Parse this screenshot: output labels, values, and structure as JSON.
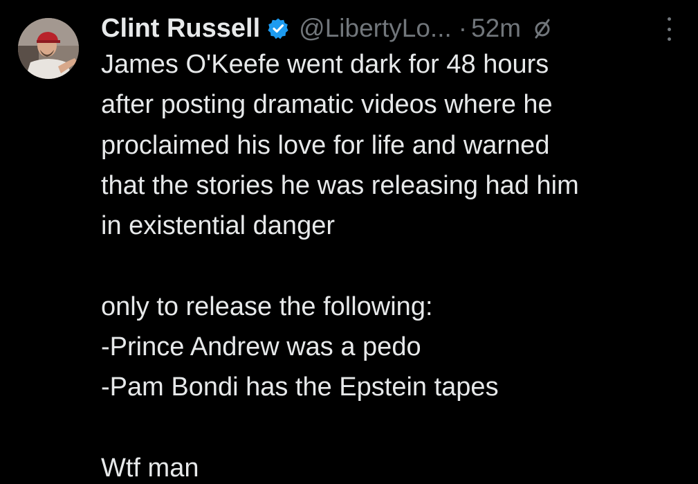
{
  "tweet": {
    "author": {
      "display_name": "Clint Russell",
      "handle": "@LibertyLo...",
      "verified": true,
      "verified_icon": "verified-badge-icon",
      "avatar_icon": "avatar"
    },
    "separator": "·",
    "timestamp": "52m",
    "edited_icon": "slashed-circle-icon",
    "more_icon": "more-vertical-icon",
    "body_lines": [
      "James O'Keefe went dark for 48 hours",
      "after posting dramatic videos where he",
      "proclaimed his love for life and warned",
      "that the stories he was releasing had him",
      "in existential danger",
      "",
      "only to release the following:",
      "-Prince Andrew was a pedo",
      "-Pam Bondi has the Epstein tapes",
      "",
      "Wtf man"
    ]
  },
  "colors": {
    "background": "#000000",
    "text_primary": "#e7e9ea",
    "text_secondary": "#71767b",
    "verified_blue": "#1d9bf0"
  }
}
